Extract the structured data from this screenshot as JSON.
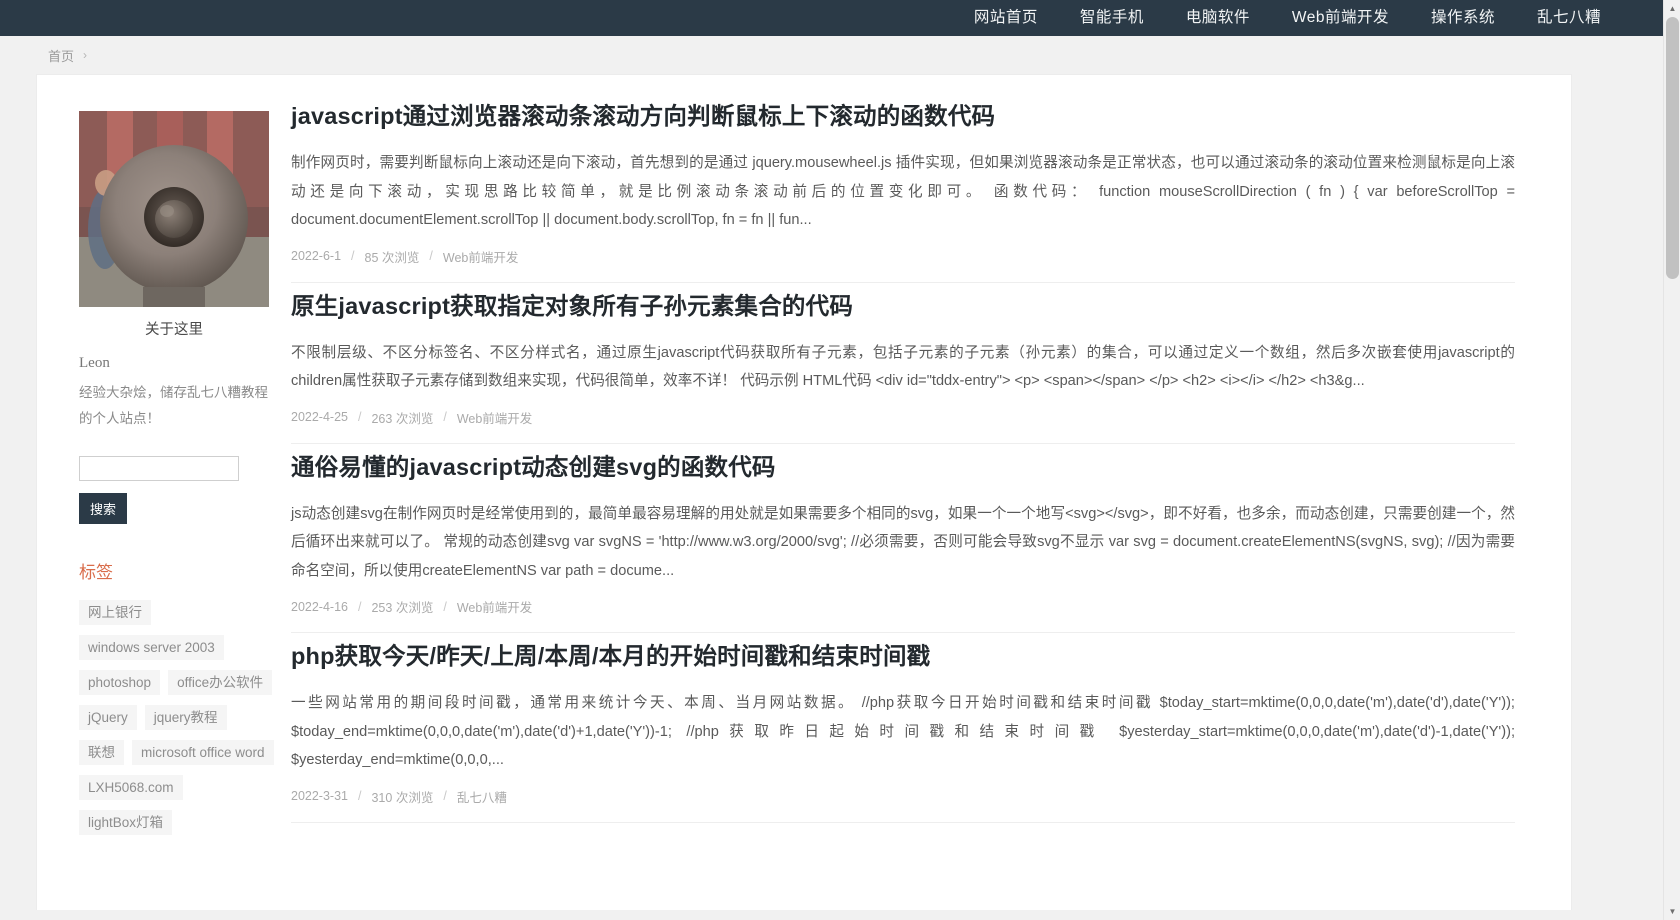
{
  "nav": {
    "items": [
      {
        "label": "网站首页"
      },
      {
        "label": "智能手机"
      },
      {
        "label": "电脑软件"
      },
      {
        "label": "Web前端开发"
      },
      {
        "label": "操作系统"
      },
      {
        "label": "乱七八糟"
      }
    ]
  },
  "breadcrumb": {
    "home": "首页",
    "separator": "›"
  },
  "sidebar": {
    "about_title": "关于这里",
    "author_name": "Leon",
    "author_desc": "经验大杂烩，储存乱七八糟教程的个人站点！",
    "search": {
      "value": "",
      "placeholder": "",
      "button_label": "搜索"
    },
    "tags_heading": "标签",
    "tags": [
      "网上银行",
      "windows server 2003",
      "photoshop",
      "office办公软件",
      "jQuery",
      "jquery教程",
      "联想",
      "microsoft office word",
      "LXH5068.com",
      "lightBox灯箱"
    ]
  },
  "main": {
    "posts": [
      {
        "title": "javascript通过浏览器滚动条滚动方向判断鼠标上下滚动的函数代码",
        "excerpt": "制作网页时，需要判断鼠标向上滚动还是向下滚动，首先想到的是通过 jquery.mousewheel.js 插件实现，但如果浏览器滚动条是正常状态，也可以通过滚动条的滚动位置来检测鼠标是向上滚动还是向下滚动，实现思路比较简单，就是比例滚动条滚动前后的位置变化即可。 函数代码： function mouseScrollDirection ( fn ) { var beforeScrollTop = document.documentElement.scrollTop || document.body.scrollTop, fn = fn || fun...",
        "date": "2022-6-1",
        "views": "85 次浏览",
        "category": "Web前端开发"
      },
      {
        "title": "原生javascript获取指定对象所有子孙元素集合的代码",
        "excerpt": "不限制层级、不区分标签名、不区分样式名，通过原生javascript代码获取所有子元素，包括子元素的子元素（孙元素）的集合，可以通过定义一个数组，然后多次嵌套使用javascript的children属性获取子元素存储到数组来实现，代码很简单，效率不详！ 代码示例 HTML代码 <div id=\"tddx-entry\"> <p> <span></span> </p> <h2> <i></i> </h2> <h3&g...",
        "date": "2022-4-25",
        "views": "263 次浏览",
        "category": "Web前端开发"
      },
      {
        "title": "通俗易懂的javascript动态创建svg的函数代码",
        "excerpt": "js动态创建svg在制作网页时是经常使用到的，最简单最容易理解的用处就是如果需要多个相同的svg，如果一个一个地写<svg></svg>，即不好看，也多余，而动态创建，只需要创建一个，然后循环出来就可以了。 常规的动态创建svg var svgNS = 'http://www.w3.org/2000/svg'; //必须需要，否则可能会导致svg不显示 var svg = document.createElementNS(svgNS, svg); //因为需要命名空间，所以使用createElementNS var path = docume...",
        "date": "2022-4-16",
        "views": "253 次浏览",
        "category": "Web前端开发"
      },
      {
        "title": "php获取今天/昨天/上周/本周/本月的开始时间戳和结束时间戳",
        "excerpt": "一些网站常用的期间段时间戳，通常用来统计今天、本周、当月网站数据。 //php获取今日开始时间戳和结束时间戳 $today_start=mktime(0,0,0,date('m'),date('d'),date('Y')); $today_end=mktime(0,0,0,date('m'),date('d')+1,date('Y'))-1; //php获取昨日起始时间戳和结束时间戳 $yesterday_start=mktime(0,0,0,date('m'),date('d')-1,date('Y')); $yesterday_end=mktime(0,0,0,...",
        "date": "2022-3-31",
        "views": "310 次浏览",
        "category": "乱七八糟"
      }
    ],
    "meta_separator": "/"
  },
  "scrollbar": {
    "up_arrow": "▲",
    "down_arrow": "▼"
  },
  "colors": {
    "nav_background": "#2b3a47",
    "accent": "#d96c4a",
    "page_background": "#f1f1f1",
    "content_background": "#ffffff"
  }
}
